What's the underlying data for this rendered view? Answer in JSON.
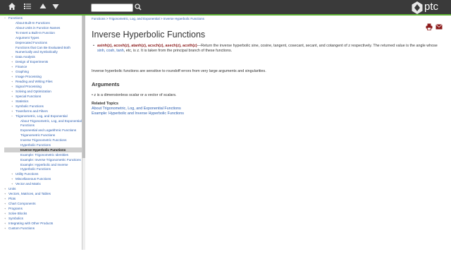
{
  "colors": {
    "topbar": "#3a3a3a",
    "accent_green": "#5fb136",
    "link": "#2a5db0",
    "function_name": "#8b1a1a"
  },
  "topbar": {
    "icons": [
      "home-icon",
      "list-icon",
      "arrow-up-icon",
      "arrow-down-icon"
    ],
    "search_placeholder": "",
    "logo_text": "ptc"
  },
  "sidebar": {
    "items": [
      {
        "label": "Functions",
        "toggle": "−",
        "level": 1
      },
      {
        "label": "About Built-In Functions",
        "toggle": "",
        "level": 2
      },
      {
        "label": "About Units in Function Names",
        "toggle": "",
        "level": 2
      },
      {
        "label": "To Insert a Built-In Function",
        "toggle": "",
        "level": 2
      },
      {
        "label": "Argument Types",
        "toggle": "",
        "level": 2
      },
      {
        "label": "Deprecated Functions",
        "toggle": "",
        "level": 2
      },
      {
        "label": "Functions that Can Be Evaluated Both Numerically and Symbolically",
        "toggle": "",
        "level": 2
      },
      {
        "label": "Data Analysis",
        "toggle": "+",
        "level": 2
      },
      {
        "label": "Design of Experiments",
        "toggle": "+",
        "level": 2
      },
      {
        "label": "Finance",
        "toggle": "+",
        "level": 2
      },
      {
        "label": "Graphing",
        "toggle": "+",
        "level": 2
      },
      {
        "label": "Image Processing",
        "toggle": "+",
        "level": 2
      },
      {
        "label": "Reading and Writing Files",
        "toggle": "+",
        "level": 2
      },
      {
        "label": "Signal Processing",
        "toggle": "+",
        "level": 2
      },
      {
        "label": "Solving and Optimization",
        "toggle": "+",
        "level": 2
      },
      {
        "label": "Special Functions",
        "toggle": "+",
        "level": 2
      },
      {
        "label": "Statistics",
        "toggle": "+",
        "level": 2
      },
      {
        "label": "Symbolic Functions",
        "toggle": "+",
        "level": 2
      },
      {
        "label": "Transforms and Filters",
        "toggle": "+",
        "level": 2
      },
      {
        "label": "Trigonometric, Log, and Exponential",
        "toggle": "−",
        "level": 2
      },
      {
        "label": "About Trigonometric, Log, and Exponential Functions",
        "toggle": "",
        "level": 3
      },
      {
        "label": "Exponential and Logarithmic Functions",
        "toggle": "",
        "level": 3
      },
      {
        "label": "Trigonometric Functions",
        "toggle": "",
        "level": 3
      },
      {
        "label": "Inverse Trigonometric Functions",
        "toggle": "",
        "level": 3
      },
      {
        "label": "Hyperbolic Functions",
        "toggle": "",
        "level": 3
      },
      {
        "label": "Inverse Hyperbolic Functions",
        "toggle": "",
        "level": 3,
        "active": true
      },
      {
        "label": "Example: Trigonometric Identities",
        "toggle": "",
        "level": 3
      },
      {
        "label": "Example: Inverse Trigonometric Functions",
        "toggle": "",
        "level": 3
      },
      {
        "label": "Example: Hyperbolic and Inverse Hyperbolic Functions",
        "toggle": "",
        "level": 3
      },
      {
        "label": "Utility Functions",
        "toggle": "+",
        "level": 2
      },
      {
        "label": "Miscellaneous Functions",
        "toggle": "+",
        "level": 2
      },
      {
        "label": "Vector and Matrix",
        "toggle": "+",
        "level": 2
      },
      {
        "label": "Units",
        "toggle": "+",
        "level": 1
      },
      {
        "label": "Vectors, Matrices, and Tables",
        "toggle": "+",
        "level": 1
      },
      {
        "label": "Plots",
        "toggle": "+",
        "level": 1
      },
      {
        "label": "Chart Components",
        "toggle": "+",
        "level": 1
      },
      {
        "label": "Programs",
        "toggle": "+",
        "level": 1
      },
      {
        "label": "Solve Blocks",
        "toggle": "+",
        "level": 1
      },
      {
        "label": "Symbolics",
        "toggle": "+",
        "level": 1
      },
      {
        "label": "Integrating with Other Products",
        "toggle": "+",
        "level": 1
      },
      {
        "label": "Custom Functions",
        "toggle": "+",
        "level": 1
      }
    ]
  },
  "content": {
    "breadcrumb": "Functions > Trigonometric, Log, and Exponential > Inverse Hyperbolic Functions",
    "title": "Inverse Hyperbolic Functions",
    "functions_names": "asinh(z), acosh(z), atanh(z), acsch(z), asech(z), acoth(z)",
    "functions_desc_1": "—Return the inverse hyperbolic sine, cosine, tangent, cosecant, secant, and cotangent of z respectively. The returned value is the angle whose ",
    "functions_links": "sinh, cosh, tanh",
    "functions_desc_2": ", etc, is z. It is taken from the principal branch of these functions.",
    "description": "Inverse hyperbolic functions are sensitive to roundoff errors from very large arguments and singularities.",
    "arguments_heading": "Arguments",
    "argument": "z is a dimensionless scalar or a vector of scalars.",
    "related_heading": "Related Topics",
    "related": [
      "About Trigonometric, Log, and Exponential Functions",
      "Example: Hyperbolic and Inverse Hyperbolic Functions"
    ]
  }
}
